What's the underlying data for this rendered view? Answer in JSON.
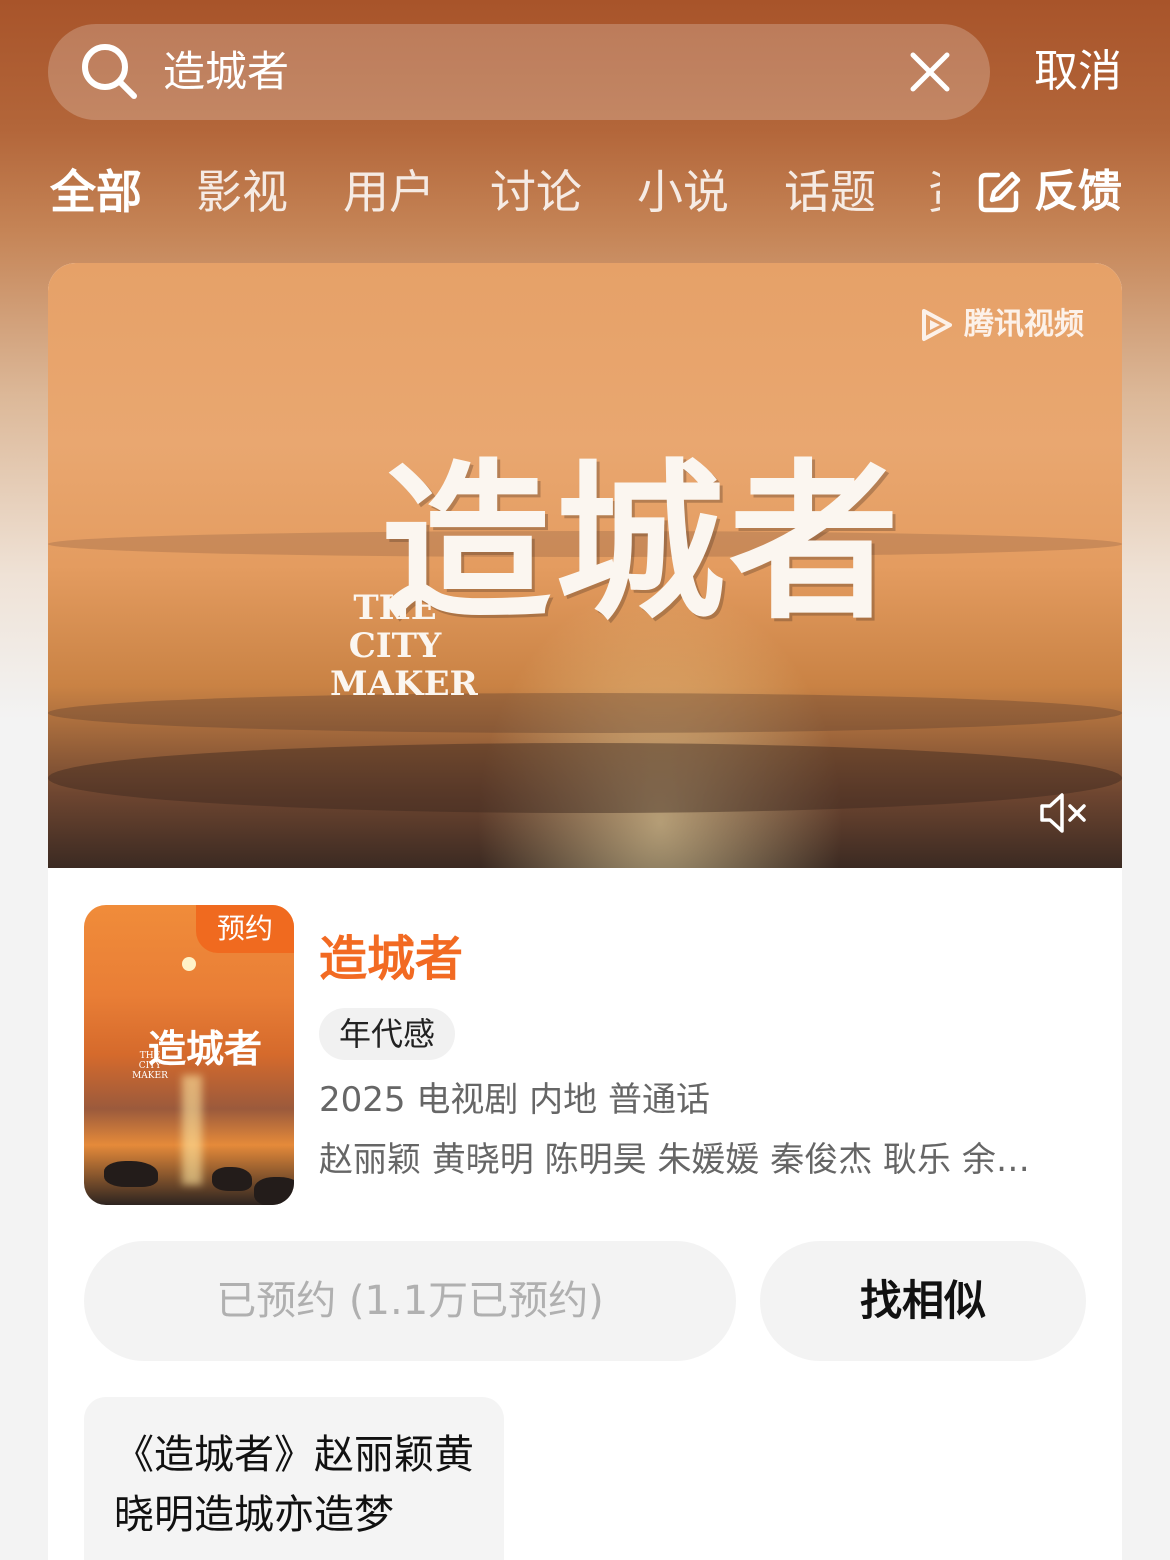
{
  "search": {
    "query": "造城者",
    "cancel_label": "取消"
  },
  "tabs": [
    {
      "label": "全部",
      "active": true
    },
    {
      "label": "影视"
    },
    {
      "label": "用户"
    },
    {
      "label": "讨论"
    },
    {
      "label": "小说"
    },
    {
      "label": "话题"
    }
  ],
  "tabs_clipped_label": "资讯",
  "feedback": {
    "label": "反馈",
    "icon": "edit-icon"
  },
  "video": {
    "title": "造城者",
    "subtitle": "THE CITY MAKER",
    "platform": "腾讯视频",
    "mute_icon": "speaker-mute-icon"
  },
  "show": {
    "poster_badge": "预约",
    "poster_title": "造城者",
    "poster_subtitle": "THE CITY MAKER",
    "title": "造城者",
    "tag": "年代感",
    "meta": "2025 电视剧 内地 普通话",
    "cast": "赵丽颖 黄晓明 陈明昊 朱媛媛 秦俊杰 耿乐 余…"
  },
  "buttons": {
    "reserved": "已预约 (1.1万已预约)",
    "similar": "找相似"
  },
  "article": {
    "title": "《造城者》赵丽颖黄晓明造城亦造梦"
  },
  "colors": {
    "accent": "#f26a22",
    "header_bg": "#a8542a"
  }
}
